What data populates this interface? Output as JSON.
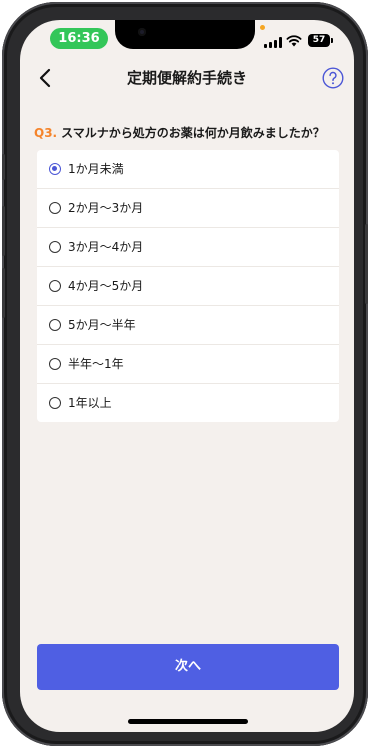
{
  "status": {
    "time": "16:36",
    "battery": "57"
  },
  "nav": {
    "title": "定期便解約手続き",
    "back_icon": "chevron-left",
    "help_icon": "question-circle"
  },
  "question": {
    "number": "Q3.",
    "text": "スマルナから処方のお薬は何か月飲みましたか？"
  },
  "options": [
    {
      "label": "1か月未満",
      "selected": true
    },
    {
      "label": "2か月〜3か月",
      "selected": false
    },
    {
      "label": "3か月〜4か月",
      "selected": false
    },
    {
      "label": "4か月〜5か月",
      "selected": false
    },
    {
      "label": "5か月〜半年",
      "selected": false
    },
    {
      "label": "半年〜1年",
      "selected": false
    },
    {
      "label": "1年以上",
      "selected": false
    }
  ],
  "footer": {
    "next_label": "次へ"
  },
  "colors": {
    "accent": "#4f5fe3",
    "question_number": "#f5842b",
    "background": "#f4f0ed",
    "status_pill": "#33c659"
  }
}
